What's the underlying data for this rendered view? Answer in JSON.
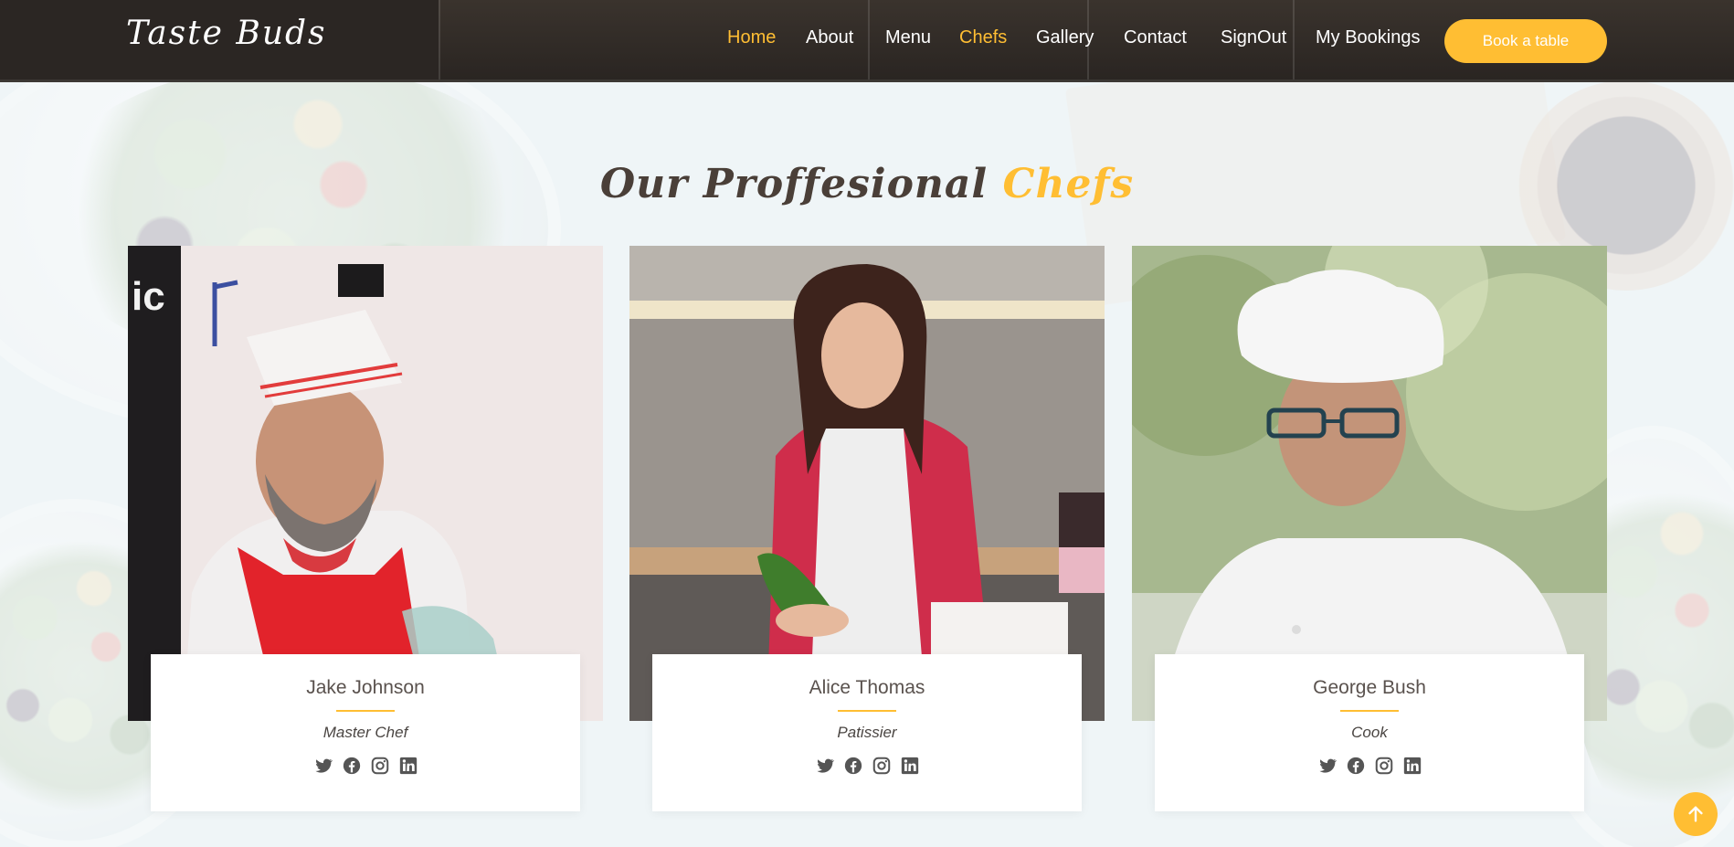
{
  "brand": {
    "name": "Taste Buds"
  },
  "nav": {
    "items": [
      {
        "label": "Home"
      },
      {
        "label": "About"
      },
      {
        "label": "Menu"
      },
      {
        "label": "Chefs"
      },
      {
        "label": "Gallery"
      },
      {
        "label": "Contact"
      },
      {
        "label": "SignOut"
      },
      {
        "label": "My Bookings"
      }
    ],
    "book_button": "Book a table"
  },
  "section": {
    "title_main": "Our Proffesional",
    "title_accent": "Chefs"
  },
  "chefs": [
    {
      "name": "Jake Johnson",
      "role": "Master Chef"
    },
    {
      "name": "Alice Thomas",
      "role": "Patissier"
    },
    {
      "name": "George Bush",
      "role": "Cook"
    }
  ],
  "social_icons": [
    "twitter-icon",
    "facebook-icon",
    "instagram-icon",
    "linkedin-icon"
  ],
  "colors": {
    "accent": "#ffbe33",
    "header_bg": "#2b2623",
    "heading": "#4a3f38"
  }
}
